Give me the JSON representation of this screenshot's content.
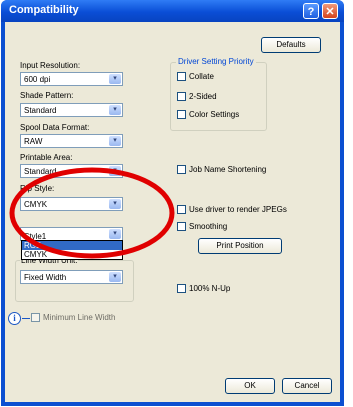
{
  "window": {
    "title": "Compatibility",
    "help_label": "?",
    "close_label": "✕"
  },
  "buttons": {
    "defaults": "Defaults",
    "print_position": "Print Position",
    "ok": "OK",
    "cancel": "Cancel"
  },
  "fields": {
    "input_resolution": {
      "label": "Input Resolution:",
      "value": "600 dpi"
    },
    "shade_pattern": {
      "label": "Shade Pattern:",
      "value": "Standard"
    },
    "spool_data_format": {
      "label": "Spool Data Format:",
      "value": "RAW"
    },
    "printable_area": {
      "label": "Printable Area:",
      "value": "Standard"
    },
    "rip_style": {
      "label": "Rip Style:",
      "value": "CMYK",
      "options": [
        "RGB",
        "CMYK"
      ],
      "obscured_value": "Style1"
    },
    "line_width_unit": {
      "label": "Line Width Unit:",
      "value": "Fixed Width"
    }
  },
  "driver_setting_priority": {
    "title": "Driver Setting Priority",
    "collate": "Collate",
    "two_sided": "2-Sided",
    "color_settings": "Color Settings"
  },
  "checkboxes": {
    "job_name_shortening": "Job Name Shortening",
    "use_driver_jpegs": "Use driver to render JPEGs",
    "smoothing": "Smoothing",
    "n_up_100": "100% N-Up",
    "minimum_line_width": "Minimum Line Width"
  },
  "info_icon_glyph": "i",
  "combo_arrow": "▾",
  "highlight_color": "#e00000"
}
